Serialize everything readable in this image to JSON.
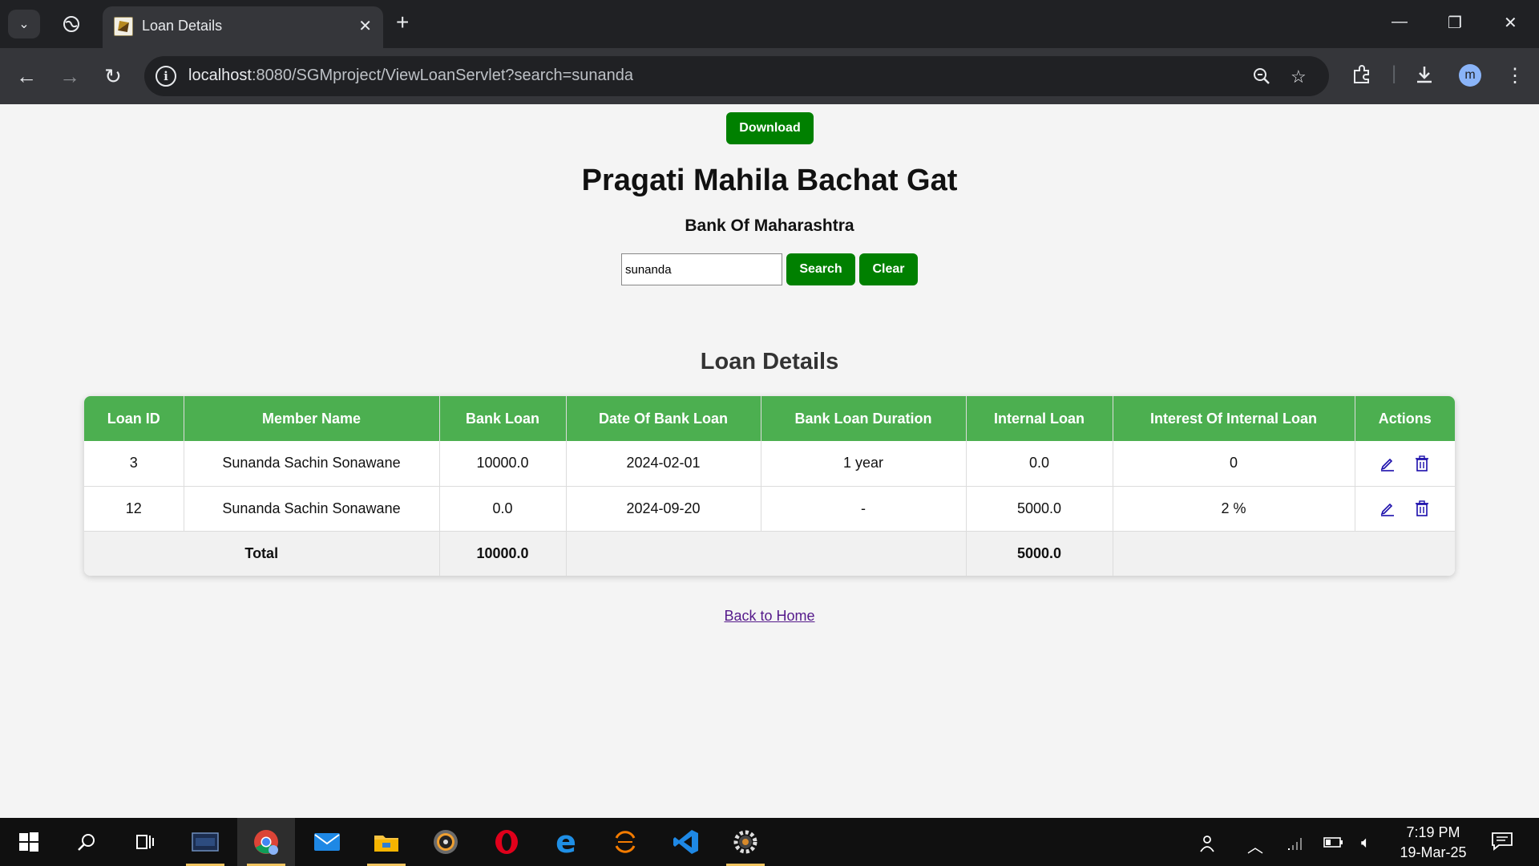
{
  "browser": {
    "tab_title": "Loan Details",
    "url_host": "localhost",
    "url_rest": ":8080/SGMproject/ViewLoanServlet?search=sunanda"
  },
  "page": {
    "download_label": "Download",
    "group_title": "Pragati Mahila Bachat Gat",
    "bank_name": "Bank Of Maharashtra",
    "search_value": "sunanda",
    "search_label": "Search",
    "clear_label": "Clear",
    "section_title": "Loan Details",
    "back_label": "Back to Home"
  },
  "table": {
    "headers": [
      "Loan ID",
      "Member Name",
      "Bank Loan",
      "Date Of Bank Loan",
      "Bank Loan Duration",
      "Internal Loan",
      "Interest Of Internal Loan",
      "Actions"
    ],
    "rows": [
      [
        "3",
        "Sunanda Sachin Sonawane",
        "10000.0",
        "2024-02-01",
        "1 year",
        "0.0",
        "0"
      ],
      [
        "12",
        "Sunanda Sachin Sonawane",
        "0.0",
        "2024-09-20",
        "-",
        "5000.0",
        "2 %"
      ]
    ],
    "total": {
      "label": "Total",
      "bank_loan": "10000.0",
      "internal_loan": "5000.0"
    }
  },
  "taskbar": {
    "time": "7:19 PM",
    "date": "19-Mar-25"
  },
  "colors": {
    "header_green": "#4caf50",
    "button_green": "#008000",
    "link_purple": "#551a8b",
    "action_blue": "#1a0dab"
  },
  "icons": {
    "edit": "pencil-icon",
    "delete": "trash-icon"
  }
}
